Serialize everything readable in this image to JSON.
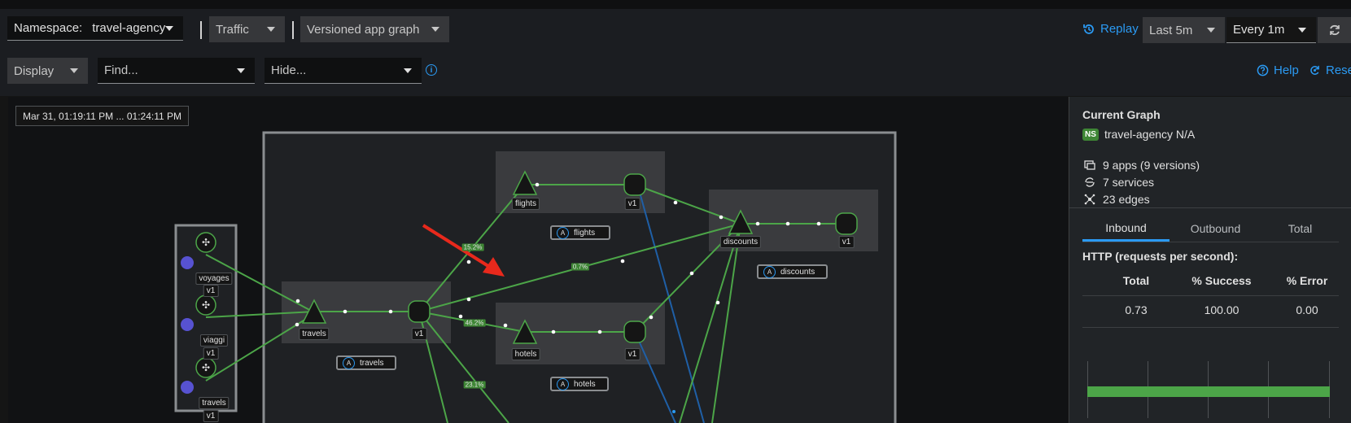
{
  "toolbar": {
    "namespace_label": "Namespace:",
    "namespace_value": "travel-agency",
    "traffic_label": "Traffic",
    "graph_type": "Versioned app graph",
    "replay_label": "Replay",
    "duration": "Last 5m",
    "refresh_interval": "Every 1m",
    "display_label": "Display",
    "find_placeholder": "Find...",
    "hide_placeholder": "Hide...",
    "help_label": "Help",
    "reset_label": "Reset"
  },
  "graph": {
    "timestamp": "Mar 31, 01:19:11 PM ... 01:24:11 PM",
    "nodes": {
      "voyages": "voyages",
      "voyages_v": "v1",
      "viaggi": "viaggi",
      "viaggi_v": "v1",
      "travels_src": "travels",
      "travels_src_v": "v1",
      "travels_svc": "travels",
      "travels_v": "v1",
      "flights_svc": "flights",
      "flights_v": "v1",
      "hotels_svc": "hotels",
      "hotels_v": "v1",
      "discounts_svc": "discounts",
      "discounts_v": "v1"
    },
    "apps": {
      "travels": "travels",
      "flights": "flights",
      "hotels": "hotels",
      "discounts": "discounts",
      "badge": "A"
    },
    "edges": {
      "to_flights": "15.2%",
      "to_discounts": "0.7%",
      "to_hotels": "46.2%",
      "to_cars": "23.1%"
    },
    "colors": {
      "edge_ok": "#4ca548",
      "edge_tcp": "#1f5fa6",
      "annotation_arrow": "#e8291c"
    }
  },
  "side_panel": {
    "title": "Current Graph",
    "ns_badge": "NS",
    "namespace": "travel-agency N/A",
    "apps": "9 apps (9 versions)",
    "services": "7 services",
    "edges": "23 edges",
    "tabs": [
      "Inbound",
      "Outbound",
      "Total"
    ],
    "active_tab": "Inbound",
    "http_title": "HTTP (requests per second):",
    "table": {
      "headers": [
        "Total",
        "% Success",
        "% Error"
      ],
      "values": [
        "0.73",
        "100.00",
        "0.00"
      ]
    }
  }
}
